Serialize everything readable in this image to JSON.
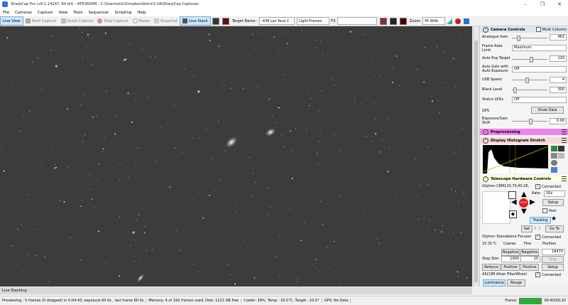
{
  "window": {
    "title": "SharpCap Pro (v4.1.14247, 64 bit) - ATR2600M - C:\\Users\\olivi\\Dropbox\\Astro\\1-VA\\SharpCap Captures",
    "min": "–",
    "restore": "❐",
    "close": "✕"
  },
  "menu": [
    "File",
    "Cameras",
    "Capture",
    "View",
    "Tools",
    "Sequencer",
    "Scripting",
    "Help"
  ],
  "toolbar": {
    "live_view": "Live View",
    "start_capture": "Start Capture",
    "quick_capture": "Quick Capture",
    "stop_capture": "Stop Capture",
    "pause": "Pause",
    "snapshot": "Snapshot",
    "live_stack": "Live Stack",
    "target_label": "Target Name :",
    "target_value": "-438 Les Yeux C",
    "frame_type": "Light Frames",
    "fx_label": "FX",
    "zoom_label": "Zoom:",
    "zoom_value": "Fit Widt"
  },
  "panel": {
    "camera_controls": {
      "title": "Camera Controls",
      "multi_column": "Multi Column",
      "analogue_gain_label": "Analogue Gain",
      "analogue_gain_value": "462",
      "frame_rate_label": "Frame Rate Limit",
      "frame_rate_value": "Maximum",
      "auto_exp_label": "Auto Exp Target",
      "auto_exp_value": "120",
      "auto_gain_label": "Auto Gain with Auto Exposure",
      "auto_gain_value": "Off",
      "usb_label": "USB Speed",
      "usb_value": "4",
      "black_label": "Black Level",
      "black_value": "300",
      "status_leds_label": "Status LEDs",
      "status_leds_value": "Off",
      "gps_label": "GPS",
      "show_data": "Show Data",
      "shift_label": "Exposure/Gain Shift",
      "shift_value": "0.00"
    },
    "preprocessing": "Preprocessing",
    "histogram": "Display Histogram Stretch",
    "telescope": {
      "title": "Telescope Hardware Controls",
      "mount": "iOptron CEM120,70,40,26,",
      "connected": "Connected",
      "rate_label": "Rate:",
      "rate_value": "16x",
      "stop": "STOP",
      "setup": "Setup",
      "park": "Park",
      "tracking": "Tracking",
      "set": "Set",
      "goto": "Go To"
    },
    "focuser": {
      "name": "iOptron Standalone Focuser",
      "connected": "Connected",
      "temp": "15.31°C",
      "coarse": "Coarse",
      "fine": "Fine",
      "position_label": "Position",
      "negative1": "Negative",
      "negative2": "Negative",
      "position_value": "18470",
      "step_label": "Step Size",
      "step_coarse": "1000",
      "step_fine": "10",
      "stop": "Stop",
      "refocus": "Refocus",
      "positive1": "Positive",
      "positive2": "Positive",
      "setup": "Setup"
    },
    "filterwheel": {
      "name": "ASCOM Altair FilterWheel",
      "connected": "Connected",
      "filter1": "Luminance",
      "filter2": "Rouge"
    }
  },
  "bottom": {
    "live_stacking": "Live Stacking",
    "preview": "Previewing : 5 frames (0 dropped) in 0:04:43, exposure 60.0s , last frame 60.0s",
    "memory": "Memory: 4 of 192 frames used, Disk: 1221 GB free",
    "cooler": "Cooler: 39%, Temp: -10.0°C, Target: -10.0°",
    "gps": "GPS: No Data",
    "frame_label": "Frame:",
    "frame_time": "00:40/00:20",
    "frame_progress": 1.0
  },
  "colors": {
    "accent_pink": "#ee82ee",
    "accent_yellow": "#ffffe0",
    "frame_green": "#1fb32a"
  }
}
